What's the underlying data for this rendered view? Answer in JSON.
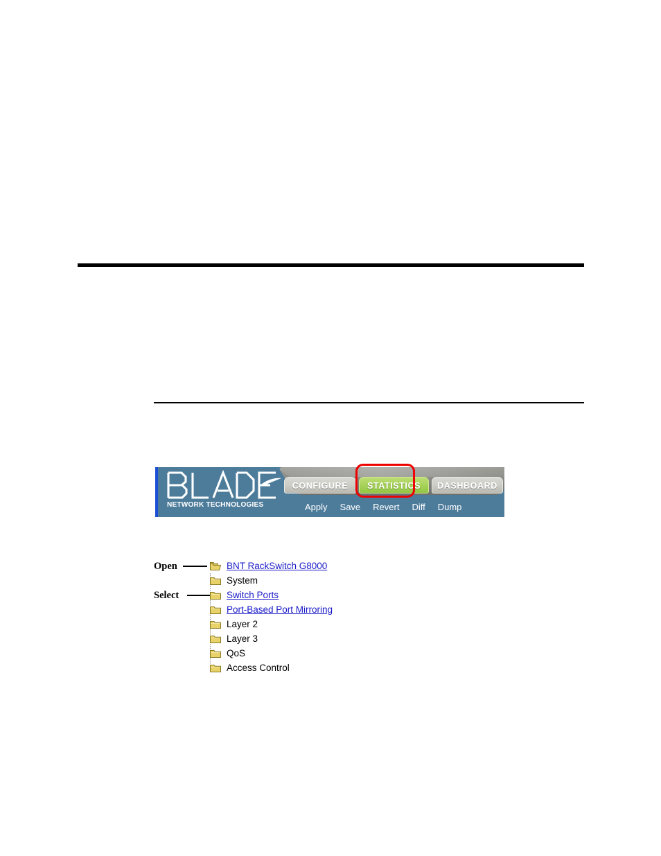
{
  "page": {
    "background": "#ffffff",
    "rules": [
      {
        "name": "thick-rule",
        "style": "thick"
      },
      {
        "name": "thin-rule",
        "style": "thin"
      }
    ]
  },
  "web_ui": {
    "banner": {
      "background_color": "#4d7c9b",
      "stripe_color": "#1b4fd6"
    },
    "logo": {
      "wordmark": "BLADE",
      "tagline": "NETWORK TECHNOLOGIES"
    },
    "tabs": [
      {
        "label": "CONFIGURE",
        "active": false,
        "color": "#cfcfc9"
      },
      {
        "label": "STATISTICS",
        "active": true,
        "color": "#a9d45c"
      },
      {
        "label": "DASHBOARD",
        "active": false,
        "color": "#cfcfc9"
      }
    ],
    "toolbar": [
      {
        "label": "Apply"
      },
      {
        "label": "Save"
      },
      {
        "label": "Revert"
      },
      {
        "label": "Diff"
      },
      {
        "label": "Dump"
      }
    ],
    "highlight": {
      "target": "STATISTICS",
      "color": "#ee0000"
    }
  },
  "nav_tree": {
    "root": {
      "label": "BNT RackSwitch G8000",
      "is_link": true,
      "icon": "open-folder-icon"
    },
    "items": [
      {
        "label": "System",
        "is_link": false,
        "icon": "folder-icon"
      },
      {
        "label": "Switch Ports",
        "is_link": true,
        "icon": "folder-icon"
      },
      {
        "label": "Port-Based Port Mirroring",
        "is_link": true,
        "icon": "folder-icon"
      },
      {
        "label": "Layer 2",
        "is_link": false,
        "icon": "folder-icon"
      },
      {
        "label": "Layer 3",
        "is_link": false,
        "icon": "folder-icon"
      },
      {
        "label": "QoS",
        "is_link": false,
        "icon": "folder-icon"
      },
      {
        "label": "Access Control",
        "is_link": false,
        "icon": "folder-icon"
      }
    ]
  },
  "annotations": {
    "open_label": "Open",
    "select_label": "Select"
  }
}
